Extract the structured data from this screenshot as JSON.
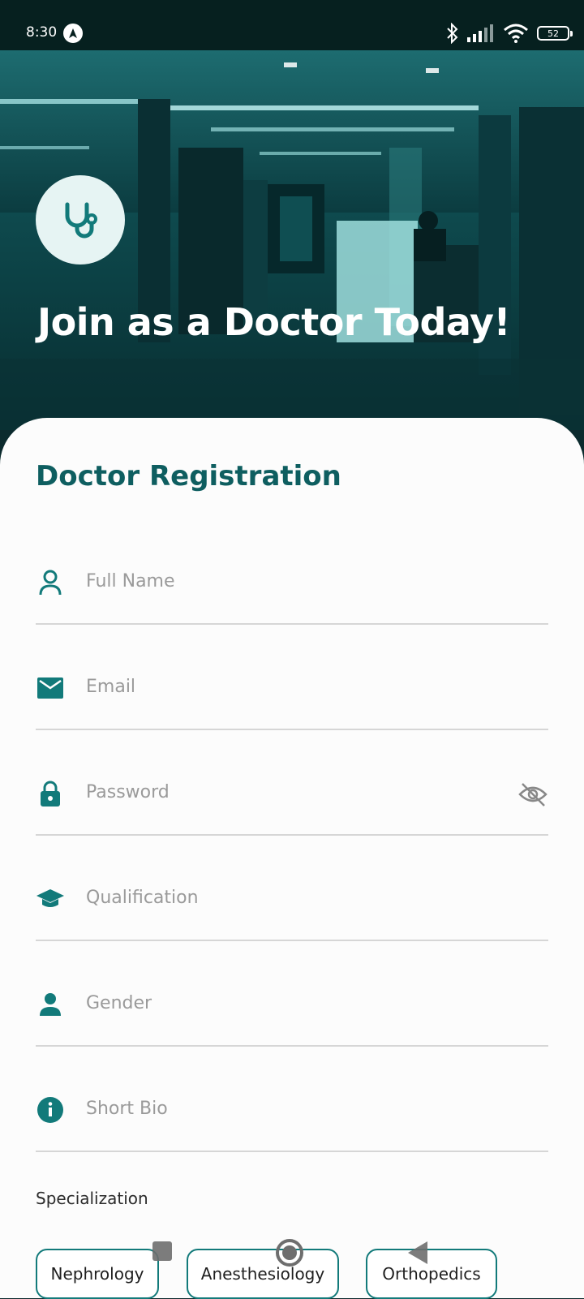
{
  "status": {
    "time": "8:30",
    "battery": "52"
  },
  "hero": {
    "title": "Join as a Doctor Today!"
  },
  "form": {
    "title": "Doctor Registration",
    "fields": [
      {
        "icon": "person-outline-icon",
        "placeholder": "Full Name"
      },
      {
        "icon": "mail-icon",
        "placeholder": "Email"
      },
      {
        "icon": "lock-icon",
        "placeholder": "Password"
      },
      {
        "icon": "graduation-cap-icon",
        "placeholder": "Qualification"
      },
      {
        "icon": "person-icon",
        "placeholder": "Gender"
      },
      {
        "icon": "info-icon",
        "placeholder": "Short Bio"
      }
    ],
    "specialization_label": "Specialization",
    "specializations": [
      "Nephrology",
      "Anesthesiology",
      "Orthopedics"
    ]
  },
  "colors": {
    "accent": "#127a7a",
    "title": "#0e5e60"
  }
}
